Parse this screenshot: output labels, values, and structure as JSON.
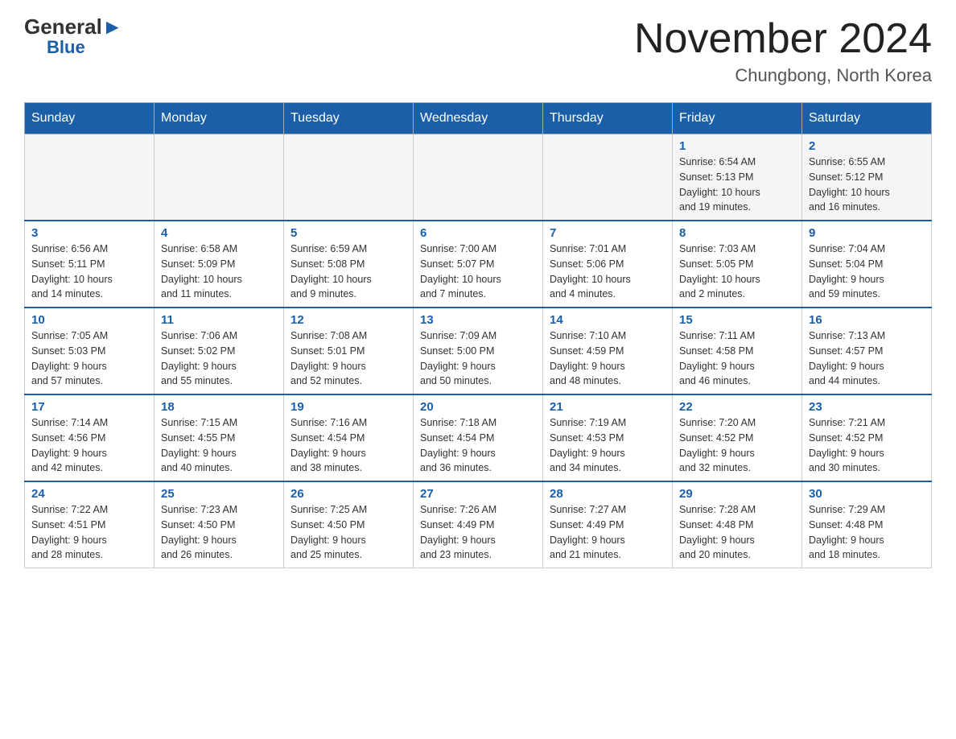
{
  "header": {
    "logo_general": "General",
    "logo_blue": "Blue",
    "month_year": "November 2024",
    "location": "Chungbong, North Korea"
  },
  "days_of_week": [
    "Sunday",
    "Monday",
    "Tuesday",
    "Wednesday",
    "Thursday",
    "Friday",
    "Saturday"
  ],
  "weeks": [
    [
      {
        "day": "",
        "info": ""
      },
      {
        "day": "",
        "info": ""
      },
      {
        "day": "",
        "info": ""
      },
      {
        "day": "",
        "info": ""
      },
      {
        "day": "",
        "info": ""
      },
      {
        "day": "1",
        "info": "Sunrise: 6:54 AM\nSunset: 5:13 PM\nDaylight: 10 hours\nand 19 minutes."
      },
      {
        "day": "2",
        "info": "Sunrise: 6:55 AM\nSunset: 5:12 PM\nDaylight: 10 hours\nand 16 minutes."
      }
    ],
    [
      {
        "day": "3",
        "info": "Sunrise: 6:56 AM\nSunset: 5:11 PM\nDaylight: 10 hours\nand 14 minutes."
      },
      {
        "day": "4",
        "info": "Sunrise: 6:58 AM\nSunset: 5:09 PM\nDaylight: 10 hours\nand 11 minutes."
      },
      {
        "day": "5",
        "info": "Sunrise: 6:59 AM\nSunset: 5:08 PM\nDaylight: 10 hours\nand 9 minutes."
      },
      {
        "day": "6",
        "info": "Sunrise: 7:00 AM\nSunset: 5:07 PM\nDaylight: 10 hours\nand 7 minutes."
      },
      {
        "day": "7",
        "info": "Sunrise: 7:01 AM\nSunset: 5:06 PM\nDaylight: 10 hours\nand 4 minutes."
      },
      {
        "day": "8",
        "info": "Sunrise: 7:03 AM\nSunset: 5:05 PM\nDaylight: 10 hours\nand 2 minutes."
      },
      {
        "day": "9",
        "info": "Sunrise: 7:04 AM\nSunset: 5:04 PM\nDaylight: 9 hours\nand 59 minutes."
      }
    ],
    [
      {
        "day": "10",
        "info": "Sunrise: 7:05 AM\nSunset: 5:03 PM\nDaylight: 9 hours\nand 57 minutes."
      },
      {
        "day": "11",
        "info": "Sunrise: 7:06 AM\nSunset: 5:02 PM\nDaylight: 9 hours\nand 55 minutes."
      },
      {
        "day": "12",
        "info": "Sunrise: 7:08 AM\nSunset: 5:01 PM\nDaylight: 9 hours\nand 52 minutes."
      },
      {
        "day": "13",
        "info": "Sunrise: 7:09 AM\nSunset: 5:00 PM\nDaylight: 9 hours\nand 50 minutes."
      },
      {
        "day": "14",
        "info": "Sunrise: 7:10 AM\nSunset: 4:59 PM\nDaylight: 9 hours\nand 48 minutes."
      },
      {
        "day": "15",
        "info": "Sunrise: 7:11 AM\nSunset: 4:58 PM\nDaylight: 9 hours\nand 46 minutes."
      },
      {
        "day": "16",
        "info": "Sunrise: 7:13 AM\nSunset: 4:57 PM\nDaylight: 9 hours\nand 44 minutes."
      }
    ],
    [
      {
        "day": "17",
        "info": "Sunrise: 7:14 AM\nSunset: 4:56 PM\nDaylight: 9 hours\nand 42 minutes."
      },
      {
        "day": "18",
        "info": "Sunrise: 7:15 AM\nSunset: 4:55 PM\nDaylight: 9 hours\nand 40 minutes."
      },
      {
        "day": "19",
        "info": "Sunrise: 7:16 AM\nSunset: 4:54 PM\nDaylight: 9 hours\nand 38 minutes."
      },
      {
        "day": "20",
        "info": "Sunrise: 7:18 AM\nSunset: 4:54 PM\nDaylight: 9 hours\nand 36 minutes."
      },
      {
        "day": "21",
        "info": "Sunrise: 7:19 AM\nSunset: 4:53 PM\nDaylight: 9 hours\nand 34 minutes."
      },
      {
        "day": "22",
        "info": "Sunrise: 7:20 AM\nSunset: 4:52 PM\nDaylight: 9 hours\nand 32 minutes."
      },
      {
        "day": "23",
        "info": "Sunrise: 7:21 AM\nSunset: 4:52 PM\nDaylight: 9 hours\nand 30 minutes."
      }
    ],
    [
      {
        "day": "24",
        "info": "Sunrise: 7:22 AM\nSunset: 4:51 PM\nDaylight: 9 hours\nand 28 minutes."
      },
      {
        "day": "25",
        "info": "Sunrise: 7:23 AM\nSunset: 4:50 PM\nDaylight: 9 hours\nand 26 minutes."
      },
      {
        "day": "26",
        "info": "Sunrise: 7:25 AM\nSunset: 4:50 PM\nDaylight: 9 hours\nand 25 minutes."
      },
      {
        "day": "27",
        "info": "Sunrise: 7:26 AM\nSunset: 4:49 PM\nDaylight: 9 hours\nand 23 minutes."
      },
      {
        "day": "28",
        "info": "Sunrise: 7:27 AM\nSunset: 4:49 PM\nDaylight: 9 hours\nand 21 minutes."
      },
      {
        "day": "29",
        "info": "Sunrise: 7:28 AM\nSunset: 4:48 PM\nDaylight: 9 hours\nand 20 minutes."
      },
      {
        "day": "30",
        "info": "Sunrise: 7:29 AM\nSunset: 4:48 PM\nDaylight: 9 hours\nand 18 minutes."
      }
    ]
  ]
}
